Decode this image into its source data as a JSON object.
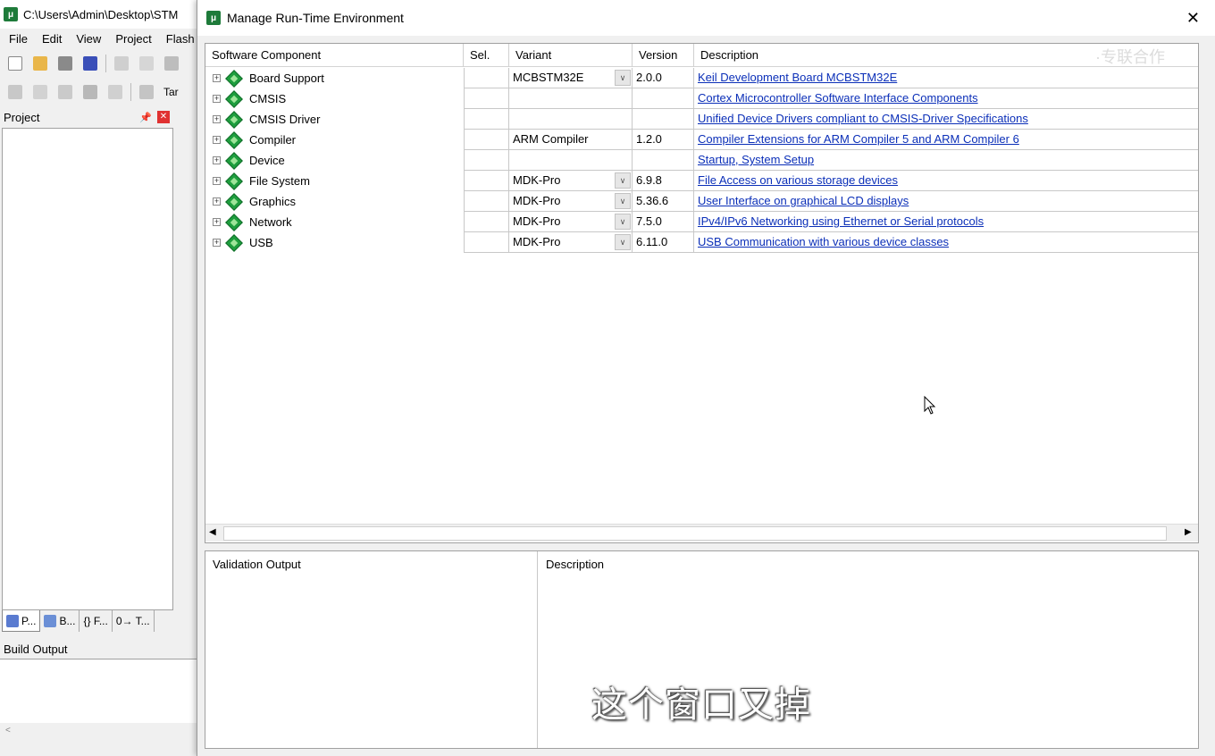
{
  "ide": {
    "title_path": "C:\\Users\\Admin\\Desktop\\STM",
    "menu": [
      "File",
      "Edit",
      "View",
      "Project",
      "Flash"
    ],
    "target_label": "Tar",
    "project_panel": {
      "title": "Project",
      "tabs": [
        "P...",
        "B...",
        "{} F...",
        "0→ T..."
      ]
    },
    "build_output_title": "Build Output"
  },
  "dialog": {
    "title": "Manage Run-Time Environment",
    "close_glyph": "✕",
    "columns": {
      "component": "Software Component",
      "sel": "Sel.",
      "variant": "Variant",
      "version": "Version",
      "description": "Description"
    },
    "rows": [
      {
        "name": "Board Support",
        "sel": "",
        "variant": "MCBSTM32E",
        "has_dropdown": true,
        "version": "2.0.0",
        "description": "Keil Development Board MCBSTM32E"
      },
      {
        "name": "CMSIS",
        "sel": "",
        "variant": "",
        "has_dropdown": false,
        "version": "",
        "description": "Cortex Microcontroller Software Interface Components"
      },
      {
        "name": "CMSIS Driver",
        "sel": "",
        "variant": "",
        "has_dropdown": false,
        "version": "",
        "description": "Unified Device Drivers compliant to CMSIS-Driver Specifications"
      },
      {
        "name": "Compiler",
        "sel": "",
        "variant": "ARM Compiler",
        "has_dropdown": false,
        "version": "1.2.0",
        "description": "Compiler Extensions for ARM Compiler 5 and ARM Compiler 6"
      },
      {
        "name": "Device",
        "sel": "",
        "variant": "",
        "has_dropdown": false,
        "version": "",
        "description": "Startup, System Setup"
      },
      {
        "name": "File System",
        "sel": "",
        "variant": "MDK-Pro",
        "has_dropdown": true,
        "version": "6.9.8",
        "description": "File Access on various storage devices"
      },
      {
        "name": "Graphics",
        "sel": "",
        "variant": "MDK-Pro",
        "has_dropdown": true,
        "version": "5.36.6",
        "description": "User Interface on graphical LCD displays"
      },
      {
        "name": "Network",
        "sel": "",
        "variant": "MDK-Pro",
        "has_dropdown": true,
        "version": "7.5.0",
        "description": "IPv4/IPv6 Networking using Ethernet or Serial protocols"
      },
      {
        "name": "USB",
        "sel": "",
        "variant": "MDK-Pro",
        "has_dropdown": true,
        "version": "6.11.0",
        "description": "USB Communication with various device classes"
      }
    ],
    "validation": {
      "output_header": "Validation Output",
      "description_header": "Description"
    }
  },
  "overlay": {
    "subtitle": "这个窗口又掉",
    "watermark": "·专联合作"
  },
  "colors": {
    "link": "#0b2fb8",
    "component_icon": "#1e9e3e",
    "close_panel": "#e03131"
  }
}
